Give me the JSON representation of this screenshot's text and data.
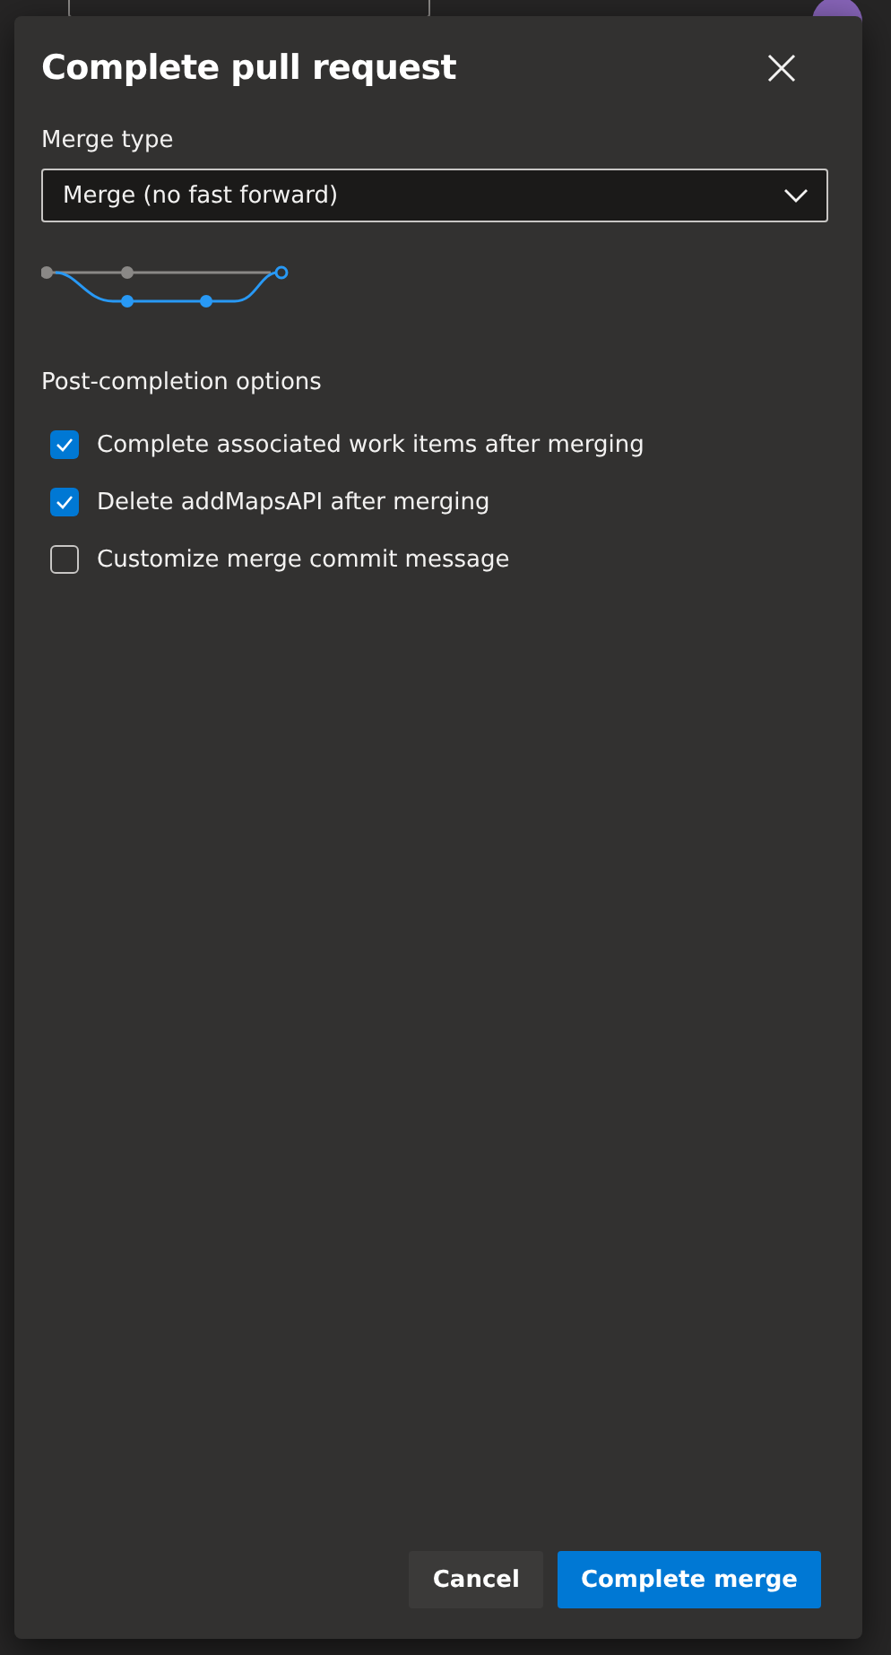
{
  "dialog": {
    "title": "Complete pull request"
  },
  "merge_type": {
    "label": "Merge type",
    "value": "Merge (no fast forward)"
  },
  "post_completion": {
    "label": "Post-completion options",
    "options": [
      {
        "label": "Complete associated work items after merging",
        "checked": true
      },
      {
        "label": "Delete addMapsAPI after merging",
        "checked": true
      },
      {
        "label": "Customize merge commit message",
        "checked": false
      }
    ]
  },
  "buttons": [
    {
      "label": "Cancel",
      "kind": "secondary"
    },
    {
      "label": "Complete merge",
      "kind": "primary"
    }
  ]
}
